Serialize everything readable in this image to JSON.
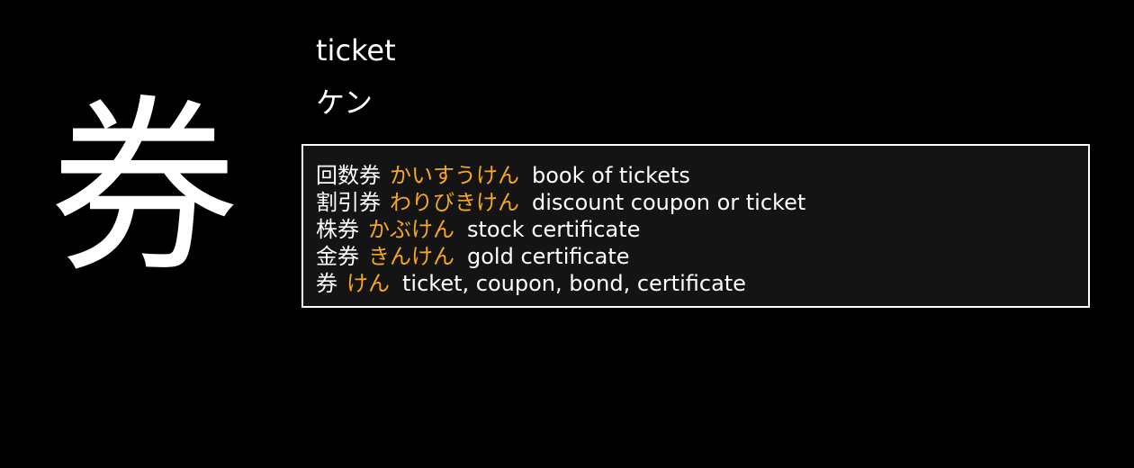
{
  "kanji": {
    "character": "券",
    "meaning": "ticket",
    "reading": "ケン"
  },
  "vocabulary": [
    {
      "word": "回数券",
      "kana": "かいすうけん",
      "gloss": "book of tickets"
    },
    {
      "word": "割引券",
      "kana": "わりびきけん",
      "gloss": "discount coupon or ticket"
    },
    {
      "word": "株券",
      "kana": "かぶけん",
      "gloss": "stock certificate"
    },
    {
      "word": "金券",
      "kana": "きんけん",
      "gloss": "gold certificate"
    },
    {
      "word": "券",
      "kana": "けん",
      "gloss": "ticket, coupon, bond, certificate"
    }
  ],
  "colors": {
    "background": "#000000",
    "text": "#ffffff",
    "kana_accent": "#f5a623",
    "box_background": "#141414",
    "box_border": "#ffffff"
  }
}
